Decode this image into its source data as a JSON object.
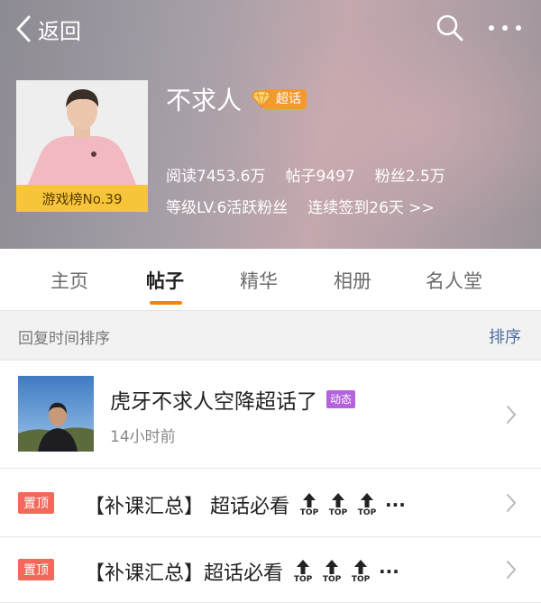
{
  "nav": {
    "back_label": "返回"
  },
  "profile": {
    "name": "不求人",
    "super_badge": "超话",
    "rank_badge": "游戏榜No.39",
    "stats": {
      "reads": "阅读7453.6万",
      "posts": "帖子9497",
      "fans": "粉丝2.5万"
    },
    "level": "等级LV.6活跃粉丝",
    "checkin": "连续签到26天 >>"
  },
  "tabs": [
    {
      "label": "主页"
    },
    {
      "label": "帖子",
      "active": true
    },
    {
      "label": "精华"
    },
    {
      "label": "相册"
    },
    {
      "label": "名人堂"
    }
  ],
  "sortbar": {
    "label": "回复时间排序",
    "sort_button": "排序"
  },
  "posts": [
    {
      "title": "虎牙不求人空降超话了",
      "badge": "动态",
      "time": "14小时前"
    },
    {
      "pin_label": "置顶",
      "title": "【补课汇总】 超话必看",
      "top_label": "TOP",
      "ellipsis": "···"
    },
    {
      "pin_label": "置顶",
      "title": "【补课汇总】超话必看",
      "top_label": "TOP",
      "ellipsis": "···"
    }
  ],
  "colors": {
    "accent": "#ff8200",
    "sort_link": "#4d6fa0",
    "pin_red": "#e24a3a",
    "badge_purple": "#b462de",
    "rank_yellow": "#f6c53a"
  }
}
